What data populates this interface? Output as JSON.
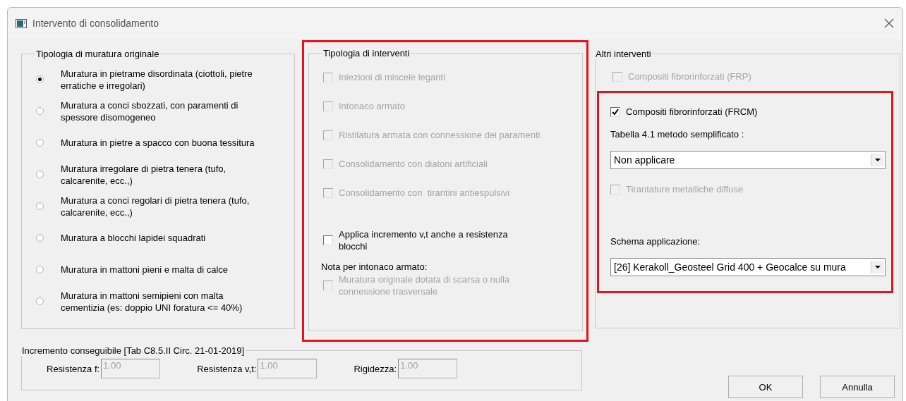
{
  "window": {
    "title": "Intervento di consolidamento"
  },
  "original_masonry": {
    "title": "Tipologia di muratura originale",
    "options": [
      {
        "label": "Muratura in pietrame disordinata (ciottoli, pietre erratiche e irregolari)",
        "selected": true
      },
      {
        "label": "Muratura a conci sbozzati, con paramenti di spessore disomogeneo",
        "selected": false
      },
      {
        "label": "Muratura in pietre a spacco con buona tessitura",
        "selected": false
      },
      {
        "label": "Muratura irregolare di pietra tenera (tufo, calcarenite, ecc.,)",
        "selected": false
      },
      {
        "label": "Muratura a conci regolari di pietra tenera (tufo, calcarenite, ecc.,)",
        "selected": false
      },
      {
        "label": "Muratura a blocchi lapidei squadrati",
        "selected": false
      },
      {
        "label": "Muratura in mattoni pieni e malta di calce",
        "selected": false
      },
      {
        "label": "Muratura in mattoni semipieni con malta cementizia (es: doppio UNI foratura <= 40%)",
        "selected": false
      }
    ]
  },
  "interventions": {
    "title": "Tipologia di interventi",
    "items": [
      {
        "label": "Iniezioni di miscele leganti",
        "checked": false,
        "disabled": true
      },
      {
        "label": "Intonaco armato",
        "checked": false,
        "disabled": true
      },
      {
        "label": "Ristilatura armata con connessione dei paramenti",
        "checked": false,
        "disabled": true
      },
      {
        "label": "Consolidamento con diatoni artificiali",
        "checked": false,
        "disabled": true
      },
      {
        "label": "Consolidamento con  tirantini antiespulsivi",
        "checked": false,
        "disabled": true
      }
    ],
    "apply_increment": {
      "label": "Applica incremento v,t anche a resistenza blocchi",
      "checked": false,
      "disabled": false
    },
    "note_label": "Nota per intonaco armato:",
    "note_option": {
      "label": "Muratura originale dotata di scarsa o nulla connessione trasversale",
      "checked": false,
      "disabled": true
    }
  },
  "other": {
    "title": "Altri interventi",
    "frp": {
      "label": "Compositi fibrorinforzati (FRP)",
      "checked": false,
      "disabled": true
    },
    "frcm": {
      "label": "Compositi fibrorinforzati (FRCM)",
      "checked": true,
      "disabled": false
    },
    "table_label": "Tabella 4.1 metodo semplificato :",
    "table_select": {
      "value": "Non applicare"
    },
    "tie_rods": {
      "label": "Tirantature metalliche diffuse",
      "checked": false,
      "disabled": true
    },
    "schema_label": "Schema applicazione:",
    "schema_select": {
      "value": "[26] Kerakoll_Geosteel Grid 400 + Geocalce su mura"
    }
  },
  "increment": {
    "title": "Incremento conseguibile [Tab C8.5.II Circ. 21-01-2019]",
    "fields": [
      {
        "label": "Resistenza f:",
        "value": "1.00",
        "disabled": true
      },
      {
        "label": "Resistenza v,t:",
        "value": "1.00",
        "disabled": true
      },
      {
        "label": "Rigidezza:",
        "value": "1.00",
        "disabled": true
      }
    ]
  },
  "buttons": [
    "OK",
    "Annulla"
  ]
}
